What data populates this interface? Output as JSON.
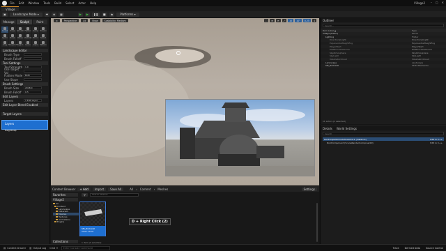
{
  "menubar": {
    "items": [
      "File",
      "Edit",
      "Window",
      "Tools",
      "Build",
      "Select",
      "Actor",
      "Help"
    ],
    "project": "Village2",
    "window_controls": [
      "–",
      "▢",
      "✕"
    ]
  },
  "document_tab": "Village",
  "toolbar": {
    "mode": "Landscape Mode",
    "platform": "Platforms"
  },
  "left_panel": {
    "mode_tabs": [
      "Manage",
      "Sculpt",
      "Paint"
    ],
    "tools": [
      "Sculpt",
      "Erase",
      "Smooth",
      "Flatten",
      "Ramp",
      "Erosion",
      "Hydro",
      "Noise",
      "Retop",
      "Visibility",
      "Mirror",
      "Select",
      "Copy",
      "Blueprint",
      "Region",
      "Lasso",
      "Alpha",
      "Pattern"
    ],
    "sections": {
      "landscape_editor": "Landscape Editor",
      "tool_settings": "Tool Settings",
      "brush_settings": "Brush Settings",
      "edit_layers": "Edit Layers",
      "blend": "Edit Layer Blend Enabled",
      "target_layers": "Target Layers"
    },
    "props": [
      {
        "k": "Brush Type",
        "v": ""
      },
      {
        "k": "Brush Falloff",
        "v": ""
      },
      {
        "k": "Tool Strength",
        "v": "1.0"
      },
      {
        "k": "Use Target Val",
        "v": ""
      },
      {
        "k": "Flatten Mode",
        "v": "Both"
      },
      {
        "k": "Use Slope",
        "v": ""
      },
      {
        "k": "Brush Size",
        "v": "2048.0"
      },
      {
        "k": "Brush Falloff",
        "v": "0.5"
      },
      {
        "k": "Layers",
        "v": "1 Edit Layer"
      }
    ],
    "layer_card": {
      "kind": "Layers",
      "name": "Heightmap"
    }
  },
  "viewport": {
    "buttons": [
      "Perspective",
      "Lit",
      "Show",
      "Scalability: Medium"
    ],
    "right_buttons": [
      "⛶",
      "⊕",
      "⟳",
      "⤢",
      "10",
      "10°",
      "0.25",
      "4"
    ]
  },
  "outliner": {
    "title": "Outliner",
    "search_placeholder": "Search...",
    "columns": [
      "Item Label ▲",
      "Type"
    ],
    "rows": [
      {
        "label": "Village (Editor)",
        "type": "World"
      },
      {
        "label": "Lighting",
        "type": "Folder"
      },
      {
        "label": "DirectionalLight",
        "type": "DirectionalLight"
      },
      {
        "label": "ExponentialHeightFog",
        "type": "ExponentialHeightFog"
      },
      {
        "label": "PlayerStart",
        "type": "PlayerStart"
      },
      {
        "label": "PostProcessVolume",
        "type": "PostProcessVolume"
      },
      {
        "label": "SkyAtmosphere",
        "type": "SkyAtmosphere"
      },
      {
        "label": "SkyLight",
        "type": "SkyLight"
      },
      {
        "label": "VolumetricCloud",
        "type": "VolumetricCloud"
      },
      {
        "label": "Landscape",
        "type": "Landscape"
      },
      {
        "label": "SM_Rockwall",
        "type": "StaticMeshActor"
      }
    ],
    "footer": "11 actors (1 selected)"
  },
  "details": {
    "title": "Details",
    "tabs": [
      "Details",
      "World Settings"
    ],
    "search_placeholder": "Search",
    "selected": "LandscapeGizmoActiveActor1 (Instance)",
    "edit_in": "Edit in C++",
    "component": "RootComponent (SceneRenderComponent0)",
    "component_link": "Edit in C++"
  },
  "content_browser": {
    "title": "Content Browser",
    "buttons": [
      "+ Add",
      "Import",
      "Save All"
    ],
    "breadcrumb": [
      "All",
      "Content",
      "Meshes"
    ],
    "settings": "Settings",
    "favorites": "Favorites",
    "root": "Village2",
    "folders": [
      "All",
      "Content",
      "Landscape",
      "Materials",
      "Meshes",
      "Textures",
      "Animations",
      "Engine"
    ],
    "search_placeholder": "Search Meshes",
    "asset": {
      "name": "SM_Rockwall",
      "type": "Static Mesh"
    },
    "item_count": "1 item (1 selected)",
    "collections": "Collections"
  },
  "tooltip": "D + Right Click (2)",
  "statusbar": {
    "left": [
      "Content Drawer",
      "Output Log",
      "Cmd"
    ],
    "cmd_placeholder": "Enter Console Command",
    "right": [
      "Trace",
      "Derived Data",
      "Source Control"
    ]
  }
}
